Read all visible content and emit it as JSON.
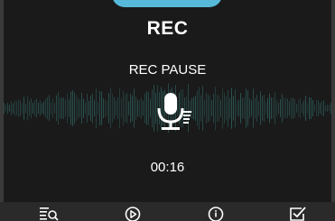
{
  "screen": {
    "title": "REC",
    "status": "REC PAUSE",
    "elapsed_time": "00:16"
  },
  "colors": {
    "accent_tab": "#57b9d9",
    "waveform": "#2c5b58",
    "background": "#1a1a1a",
    "bottom_bar": "#2a2a2a"
  },
  "icons": {
    "center": "microphone-icon",
    "bottom_bar": [
      "recording-list-icon",
      "play-icon",
      "info-icon",
      "checkbox-icon"
    ]
  }
}
